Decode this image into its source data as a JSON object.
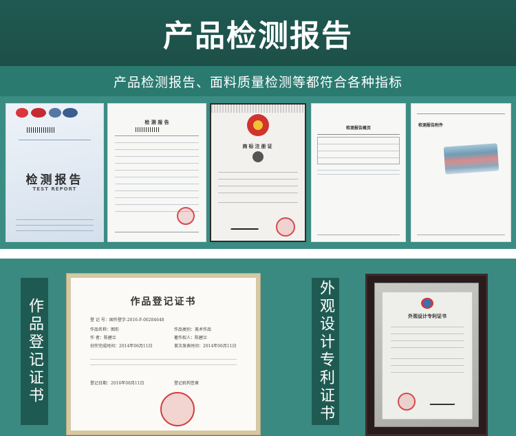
{
  "header": {
    "title": "产品检测报告"
  },
  "subheader": {
    "subtitle": "产品检测报告、面料质量检测等都符合各种指标"
  },
  "documents": {
    "report_main": {
      "heading": "检测报告",
      "heading_en": "TEST REPORT"
    },
    "report_page": {
      "heading": "检 测 报 告"
    },
    "trademark": {
      "heading": "商标注册证"
    },
    "summary": {
      "heading": "检测报告概页"
    },
    "attachment": {
      "heading": "检测报告附件"
    }
  },
  "bottom": {
    "left_label": "作品登记证书",
    "right_label": "外观设计专利证书",
    "certificate": {
      "title": "作品登记证书",
      "reg_no_label": "登 记 号：",
      "reg_no": "国作登字-2016-F-00284648",
      "work_name_label": "作品名称：",
      "work_name": "图形",
      "category_label": "作品类别：",
      "category": "美术作品",
      "author_label": "作      者：",
      "author": "陈碧兰",
      "owner_label": "著作权人：",
      "owner": "陈碧兰",
      "complete_date_label": "创作完成时间：",
      "complete_date": "2014年06月11日",
      "publish_date_label": "首次发表时间：",
      "publish_date": "2014年06月11日",
      "reg_date_label": "登记日期：",
      "reg_date": "2016年08月11日",
      "org_label": "登记机构签章"
    },
    "patent": {
      "title": "外观设计专利证书"
    }
  },
  "colors": {
    "header_bg": "#1f5a52",
    "sub_bg": "#2a7a70",
    "panel_bg": "#3b8c83",
    "stamp_red": "#d54a4a"
  }
}
